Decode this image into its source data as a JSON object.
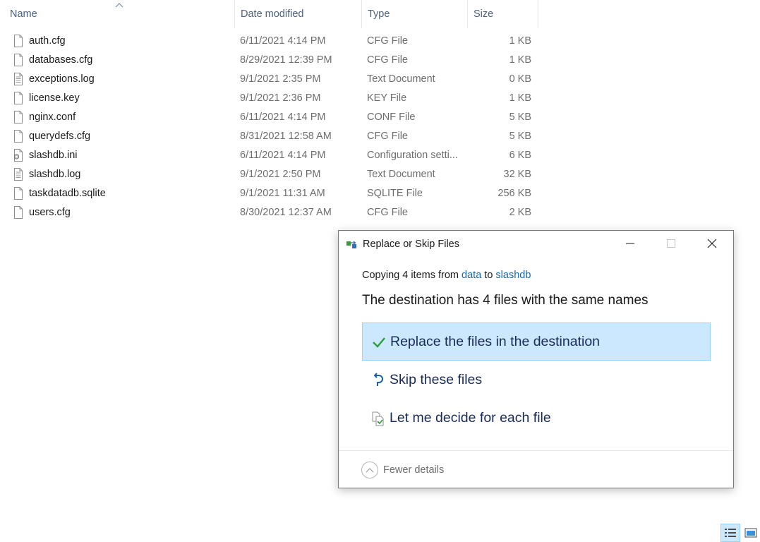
{
  "columns": {
    "name": "Name",
    "date": "Date modified",
    "type": "Type",
    "size": "Size"
  },
  "files": [
    {
      "name": "auth.cfg",
      "date": "6/11/2021 4:14 PM",
      "type": "CFG File",
      "size": "1 KB",
      "icon": "file-icon"
    },
    {
      "name": "databases.cfg",
      "date": "8/29/2021 12:39 PM",
      "type": "CFG File",
      "size": "1 KB",
      "icon": "file-icon"
    },
    {
      "name": "exceptions.log",
      "date": "9/1/2021 2:35 PM",
      "type": "Text Document",
      "size": "0 KB",
      "icon": "text-file-icon"
    },
    {
      "name": "license.key",
      "date": "9/1/2021 2:36 PM",
      "type": "KEY File",
      "size": "1 KB",
      "icon": "file-icon"
    },
    {
      "name": "nginx.conf",
      "date": "6/11/2021 4:14 PM",
      "type": "CONF File",
      "size": "5 KB",
      "icon": "file-icon"
    },
    {
      "name": "querydefs.cfg",
      "date": "8/31/2021 12:58 AM",
      "type": "CFG File",
      "size": "5 KB",
      "icon": "file-icon"
    },
    {
      "name": "slashdb.ini",
      "date": "6/11/2021 4:14 PM",
      "type": "Configuration setti...",
      "size": "6 KB",
      "icon": "settings-file-icon"
    },
    {
      "name": "slashdb.log",
      "date": "9/1/2021 2:50 PM",
      "type": "Text Document",
      "size": "32 KB",
      "icon": "text-file-icon"
    },
    {
      "name": "taskdatadb.sqlite",
      "date": "9/1/2021 11:31 AM",
      "type": "SQLITE File",
      "size": "256 KB",
      "icon": "file-icon"
    },
    {
      "name": "users.cfg",
      "date": "8/30/2021 12:37 AM",
      "type": "CFG File",
      "size": "2 KB",
      "icon": "file-icon"
    }
  ],
  "dialog": {
    "title": "Replace or Skip Files",
    "copying_prefix": "Copying 4 items from",
    "source": "data",
    "copying_mid": "to",
    "destination": "slashdb",
    "headline": "The destination has 4 files with the same names",
    "options": [
      {
        "label": "Replace the files in the destination",
        "icon": "checkmark-icon",
        "selected": true
      },
      {
        "label": "Skip these files",
        "icon": "skip-arrow-icon",
        "selected": false
      },
      {
        "label": "Let me decide for each file",
        "icon": "decide-files-icon",
        "selected": false
      }
    ],
    "fewer_details": "Fewer details"
  },
  "colors": {
    "accent_selected_bg": "#cce8ff",
    "accent_selected_border": "#99d1ff",
    "link": "#1a66b3",
    "checkmark": "#2e9d3a",
    "option_text": "#1a2b57"
  }
}
